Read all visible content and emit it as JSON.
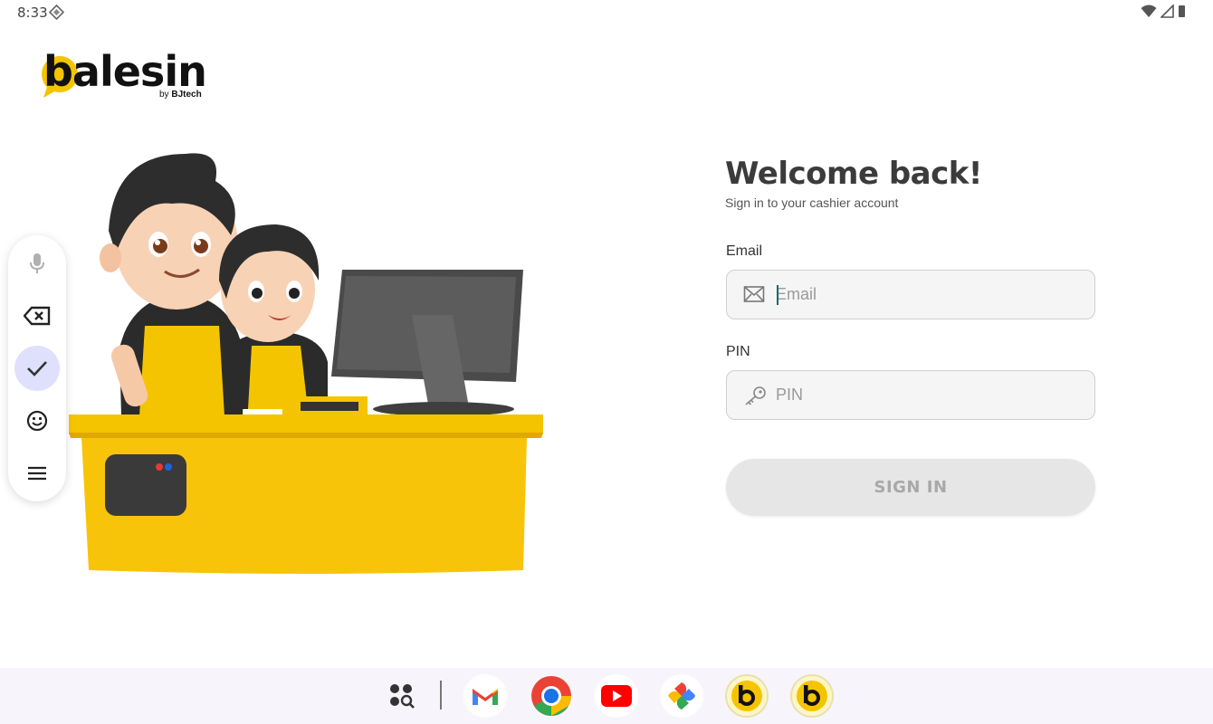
{
  "status_bar": {
    "time": "8:33"
  },
  "logo": {
    "word": "balesin",
    "by": "by ",
    "brand": "BJtech"
  },
  "login": {
    "title": "Welcome back!",
    "subtitle": "Sign in to your cashier account",
    "email_label": "Email",
    "email_placeholder": "Email",
    "email_value": "",
    "pin_label": "PIN",
    "pin_placeholder": "PIN",
    "pin_value": "",
    "sign_in_label": "SIGN IN"
  },
  "keyboard_toolbar": {
    "items": [
      "microphone-icon",
      "backspace-icon",
      "check-icon",
      "emoji-icon",
      "menu-icon"
    ],
    "active": "check-icon"
  },
  "taskbar": {
    "apps": [
      "app-drawer",
      "gmail",
      "chrome",
      "youtube",
      "photos",
      "balesin",
      "balesin"
    ]
  },
  "colors": {
    "brand_yellow": "#f5c400",
    "dark": "#3b3b3b",
    "button_disabled": "#e6e6e6"
  }
}
